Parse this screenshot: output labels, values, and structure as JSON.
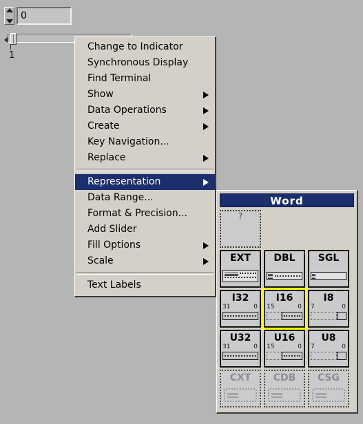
{
  "numeric_control": {
    "value": "0",
    "increment_icon": "spin-up-arrow-icon",
    "decrement_icon": "spin-down-arrow-icon"
  },
  "slider_control": {
    "scale_label": "1"
  },
  "context_menu": {
    "items": [
      {
        "label": "Change to Indicator",
        "submenu": false,
        "highlighted": false
      },
      {
        "label": "Synchronous Display",
        "submenu": false,
        "highlighted": false
      },
      {
        "label": "Find Terminal",
        "submenu": false,
        "highlighted": false
      },
      {
        "label": "Show",
        "submenu": true,
        "highlighted": false
      },
      {
        "label": "Data Operations",
        "submenu": true,
        "highlighted": false
      },
      {
        "label": "Create",
        "submenu": true,
        "highlighted": false
      },
      {
        "label": "Key Navigation...",
        "submenu": false,
        "highlighted": false
      },
      {
        "label": "Replace",
        "submenu": true,
        "highlighted": false
      },
      {
        "separator": true
      },
      {
        "label": "Representation",
        "submenu": true,
        "highlighted": true
      },
      {
        "label": "Data Range...",
        "submenu": false,
        "highlighted": false
      },
      {
        "label": "Format & Precision...",
        "submenu": false,
        "highlighted": false
      },
      {
        "label": "Add Slider",
        "submenu": false,
        "highlighted": false
      },
      {
        "label": "Fill Options",
        "submenu": true,
        "highlighted": false
      },
      {
        "label": "Scale",
        "submenu": true,
        "highlighted": false
      },
      {
        "separator": true
      },
      {
        "label": "Text Labels",
        "submenu": false,
        "highlighted": false
      }
    ]
  },
  "representation_palette": {
    "title": "Word",
    "empty_cell_mark": "?",
    "rows": [
      {
        "cells": [
          {
            "label": "EXT",
            "glyph": "ext-register",
            "msb": "",
            "lsb": "",
            "selected": false,
            "disabled": false
          },
          {
            "label": "DBL",
            "glyph": "dbl-register",
            "msb": "",
            "lsb": "",
            "selected": false,
            "disabled": false
          },
          {
            "label": "SGL",
            "glyph": "sgl-register",
            "msb": "",
            "lsb": "",
            "selected": false,
            "disabled": false
          }
        ]
      },
      {
        "cells": [
          {
            "label": "I32",
            "glyph": "int-register",
            "msb": "31",
            "lsb": "0",
            "selected": false,
            "disabled": false
          },
          {
            "label": "I16",
            "glyph": "int-register",
            "msb": "15",
            "lsb": "0",
            "selected": true,
            "disabled": false
          },
          {
            "label": "I8",
            "glyph": "int-register",
            "msb": "7",
            "lsb": "0",
            "selected": false,
            "disabled": false
          }
        ]
      },
      {
        "cells": [
          {
            "label": "U32",
            "glyph": "int-register",
            "msb": "31",
            "lsb": "0",
            "selected": false,
            "disabled": false
          },
          {
            "label": "U16",
            "glyph": "int-register",
            "msb": "15",
            "lsb": "0",
            "selected": false,
            "disabled": false
          },
          {
            "label": "U8",
            "glyph": "int-register",
            "msb": "7",
            "lsb": "0",
            "selected": false,
            "disabled": false
          }
        ]
      },
      {
        "cells": [
          {
            "label": "CXT",
            "glyph": "complex-register",
            "msb": "",
            "lsb": "",
            "selected": false,
            "disabled": true
          },
          {
            "label": "CDB",
            "glyph": "complex-register",
            "msb": "",
            "lsb": "",
            "selected": false,
            "disabled": true
          },
          {
            "label": "CSG",
            "glyph": "complex-register",
            "msb": "",
            "lsb": "",
            "selected": false,
            "disabled": true
          }
        ]
      }
    ]
  },
  "colors": {
    "canvas_background": "#b5b5b5",
    "menu_background": "#d4d0c8",
    "highlight_blue": "#1b2f6e",
    "selection_yellow": "#ffff00",
    "cell_background": "#cbcbcb",
    "text": "#000000"
  }
}
